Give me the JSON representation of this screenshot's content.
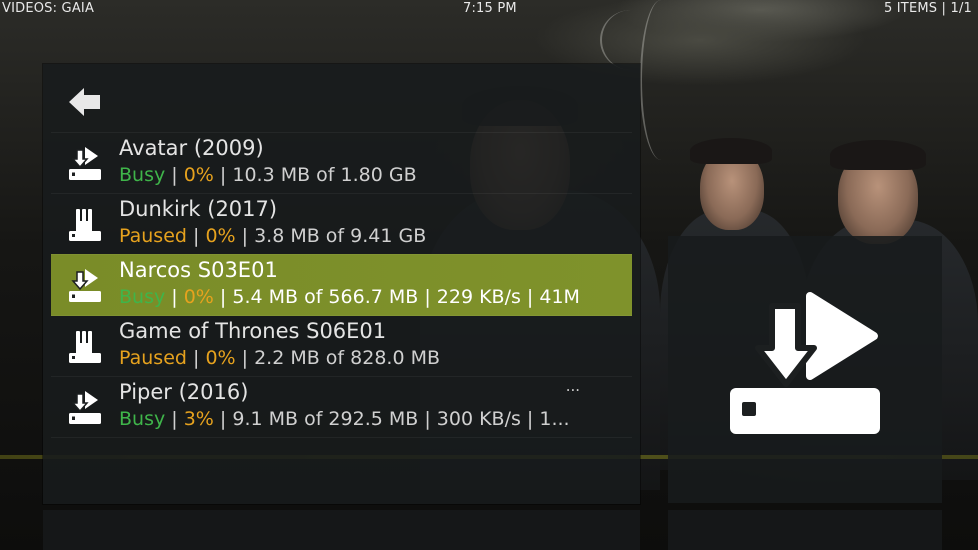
{
  "header": {
    "section": "VIDEOS: GAIA",
    "time": "7:15 PM",
    "item_count": "5 ITEMS | 1/1"
  },
  "colors": {
    "busy": "#3fb54a",
    "paused": "#e6a21e",
    "percent": "#e6a21e",
    "selection": "#7b8e2a"
  },
  "icons": {
    "back": "back-arrow-icon",
    "downloading": "download-tray-icon",
    "paused": "paused-tray-icon",
    "preview": "download-play-icon"
  },
  "list": {
    "items": [
      {
        "title": "Avatar (2009)",
        "status": "Busy",
        "percent": "0%",
        "details": "10.3 MB of 1.80 GB",
        "state": "busy",
        "selected": false
      },
      {
        "title": "Dunkirk (2017)",
        "status": "Paused",
        "percent": "0%",
        "details": "3.8 MB of 9.41 GB",
        "state": "paused",
        "selected": false
      },
      {
        "title": "Narcos S03E01",
        "status": "Busy",
        "percent": "0%",
        "details": "5.4 MB of 566.7 MB | 229 KB/s | 41M",
        "state": "busy",
        "selected": true
      },
      {
        "title": "Game of Thrones S06E01",
        "status": "Paused",
        "percent": "0%",
        "details": "2.2 MB of 828.0 MB",
        "state": "paused",
        "selected": false
      },
      {
        "title": "Piper (2016)",
        "status": "Busy",
        "percent": "3%",
        "details": "9.1 MB of 292.5 MB | 300 KB/s | 1...",
        "state": "busy",
        "selected": false,
        "more": "..."
      }
    ]
  }
}
